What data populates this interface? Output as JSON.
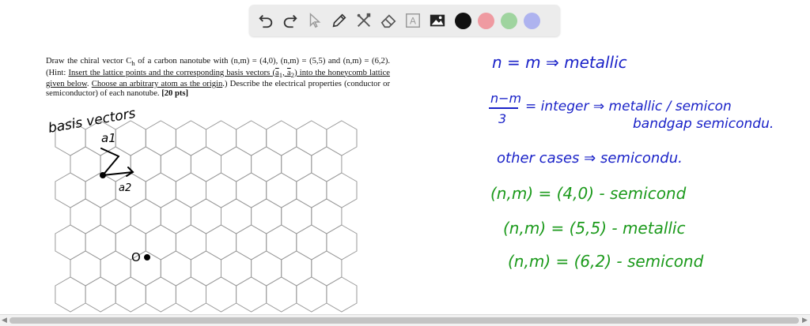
{
  "toolbar": {
    "tools": [
      "undo-icon",
      "redo-icon",
      "pointer-icon",
      "pen-icon",
      "tools-icon",
      "eraser-icon",
      "text-icon",
      "image-icon"
    ],
    "text_tool_label": "A",
    "colors": [
      "#111111",
      "#ef9aa1",
      "#9fd49f",
      "#aeb3ef"
    ]
  },
  "problem": {
    "p1": "Draw the chiral vector C",
    "p1_sub": "h",
    "p2": " of a carbon nanotube with (n,m) = (4,0), (n,m) = (5,5) and (n,m) = (6,2). (Hint: ",
    "u1": "Insert the lattice points and the corresponding basis vectors (",
    "a1": "a",
    "a1_sub": "1",
    "sep": ", ",
    "a2": "a",
    "a2_sub": "2",
    "u1_end": ") into the honeycomb lattice given below",
    "p3": ". ",
    "u2": "Choose an arbitrary atom as the origin",
    "p4": ".) Describe the electrical properties (conductor or semiconductor) of each nanotube. ",
    "points": "[20 pts]"
  },
  "annotations": {
    "basis_vectors": "basis vectors",
    "a1_label": "a1",
    "a2_label": "a2",
    "origin_label": "O",
    "blue_line1": "n = m ⇒ metallic",
    "blue_frac_num": "n−m",
    "blue_frac_den": "3",
    "blue_line2a": "= integer ⇒ metallic / semicon",
    "blue_line2b": "bandgap semicondu.",
    "blue_line3": "other cases ⇒ semicondu.",
    "green_line1": "(n,m) = (4,0) - semicond",
    "green_line2": "(n,m) = (5,5) - metallic",
    "green_line3": "(n,m) = (6,2) - semicond"
  },
  "colors": {
    "blue_ink": "#1a22c8",
    "green_ink": "#1c9a1c",
    "black_ink": "#000000",
    "lattice": "#9a9a9a"
  }
}
